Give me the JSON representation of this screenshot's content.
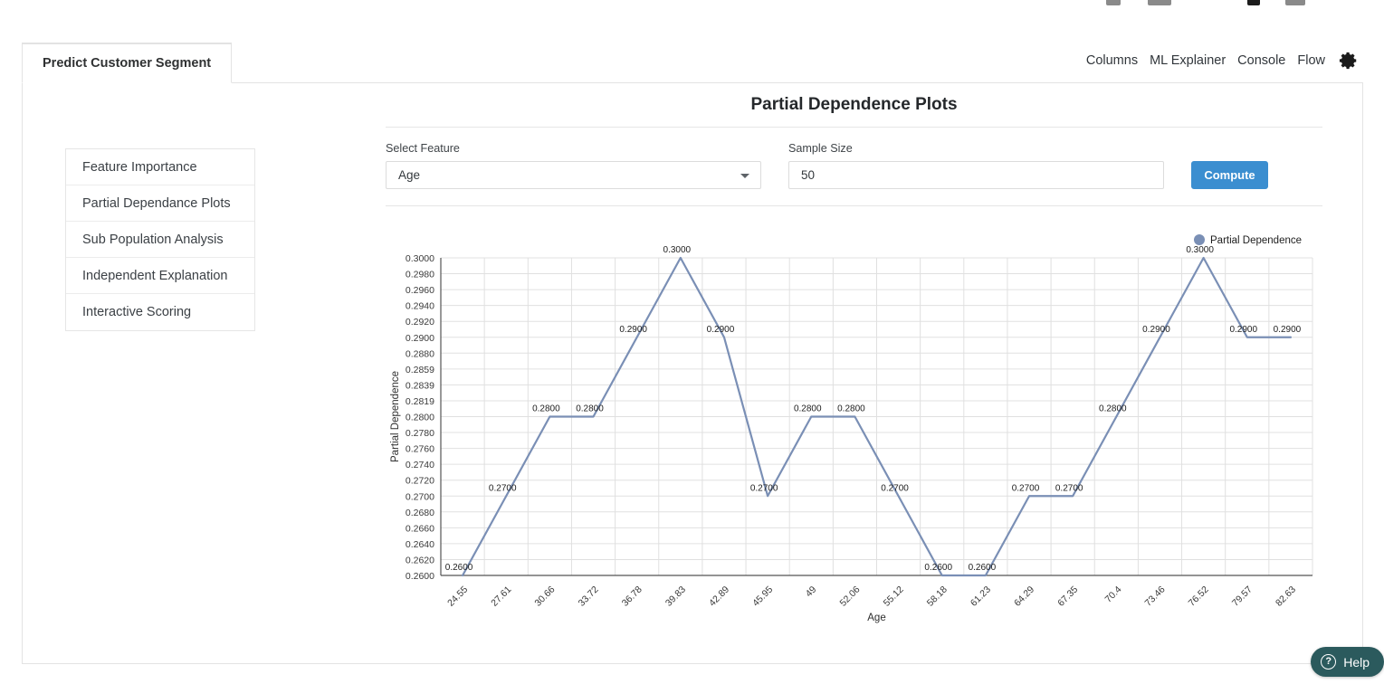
{
  "header": {
    "tab_label": "Predict Customer Segment",
    "nav_links": [
      "Columns",
      "ML Explainer",
      "Console",
      "Flow"
    ],
    "gear_icon": "gear-icon"
  },
  "sidebar": {
    "items": [
      {
        "label": "Feature Importance"
      },
      {
        "label": "Partial Dependance Plots"
      },
      {
        "label": "Sub Population Analysis"
      },
      {
        "label": "Independent Explanation"
      },
      {
        "label": "Interactive Scoring"
      }
    ]
  },
  "main": {
    "title": "Partial Dependence Plots",
    "select_feature_label": "Select Feature",
    "select_feature_value": "Age",
    "sample_size_label": "Sample Size",
    "sample_size_value": "50",
    "sample_size_placeholder": "Sample Size",
    "compute_label": "Compute"
  },
  "help": {
    "label": "Help",
    "icon_glyph": "?"
  },
  "colors": {
    "accent_button": "#3b8ed0",
    "line": "#7a8fb5",
    "grid": "#e0e0e0",
    "axis": "#5b5b5b",
    "help_bg": "#2b5a5d"
  },
  "chart_data": {
    "type": "line",
    "title": "",
    "xlabel": "Age",
    "ylabel": "Partial Dependence",
    "legend": [
      "Partial Dependence"
    ],
    "legend_position": "top-right",
    "grid": true,
    "ylim": [
      0.26,
      0.3
    ],
    "ytick_labels": [
      "0.3000",
      "0.2980",
      "0.2960",
      "0.2940",
      "0.2920",
      "0.2900",
      "0.2880",
      "0.2859",
      "0.2839",
      "0.2819",
      "0.2800",
      "0.2780",
      "0.2760",
      "0.2740",
      "0.2720",
      "0.2700",
      "0.2680",
      "0.2660",
      "0.2640",
      "0.2620",
      "0.2600"
    ],
    "categories": [
      "24.55",
      "27.61",
      "30.66",
      "33.72",
      "36.78",
      "39.83",
      "42.89",
      "45.95",
      "49",
      "52.06",
      "55.12",
      "58.18",
      "61.23",
      "64.29",
      "67.35",
      "70.4",
      "73.46",
      "76.52",
      "79.57",
      "82.63"
    ],
    "values": [
      0.26,
      0.27,
      0.28,
      0.28,
      0.29,
      0.3,
      0.29,
      0.27,
      0.28,
      0.28,
      0.27,
      0.26,
      0.26,
      0.27,
      0.27,
      0.28,
      0.29,
      0.3,
      0.29,
      0.29
    ],
    "point_labels": [
      "0.2600",
      "0.2700",
      "0.2800",
      "0.2800",
      "0.2900",
      "0.3000",
      "0.2900",
      "0.2700",
      "0.2800",
      "0.2800",
      "0.2700",
      "0.2600",
      "0.2600",
      "0.2700",
      "0.2700",
      "0.2800",
      "0.2900",
      "0.3000",
      "0.2900",
      "0.2900"
    ]
  }
}
